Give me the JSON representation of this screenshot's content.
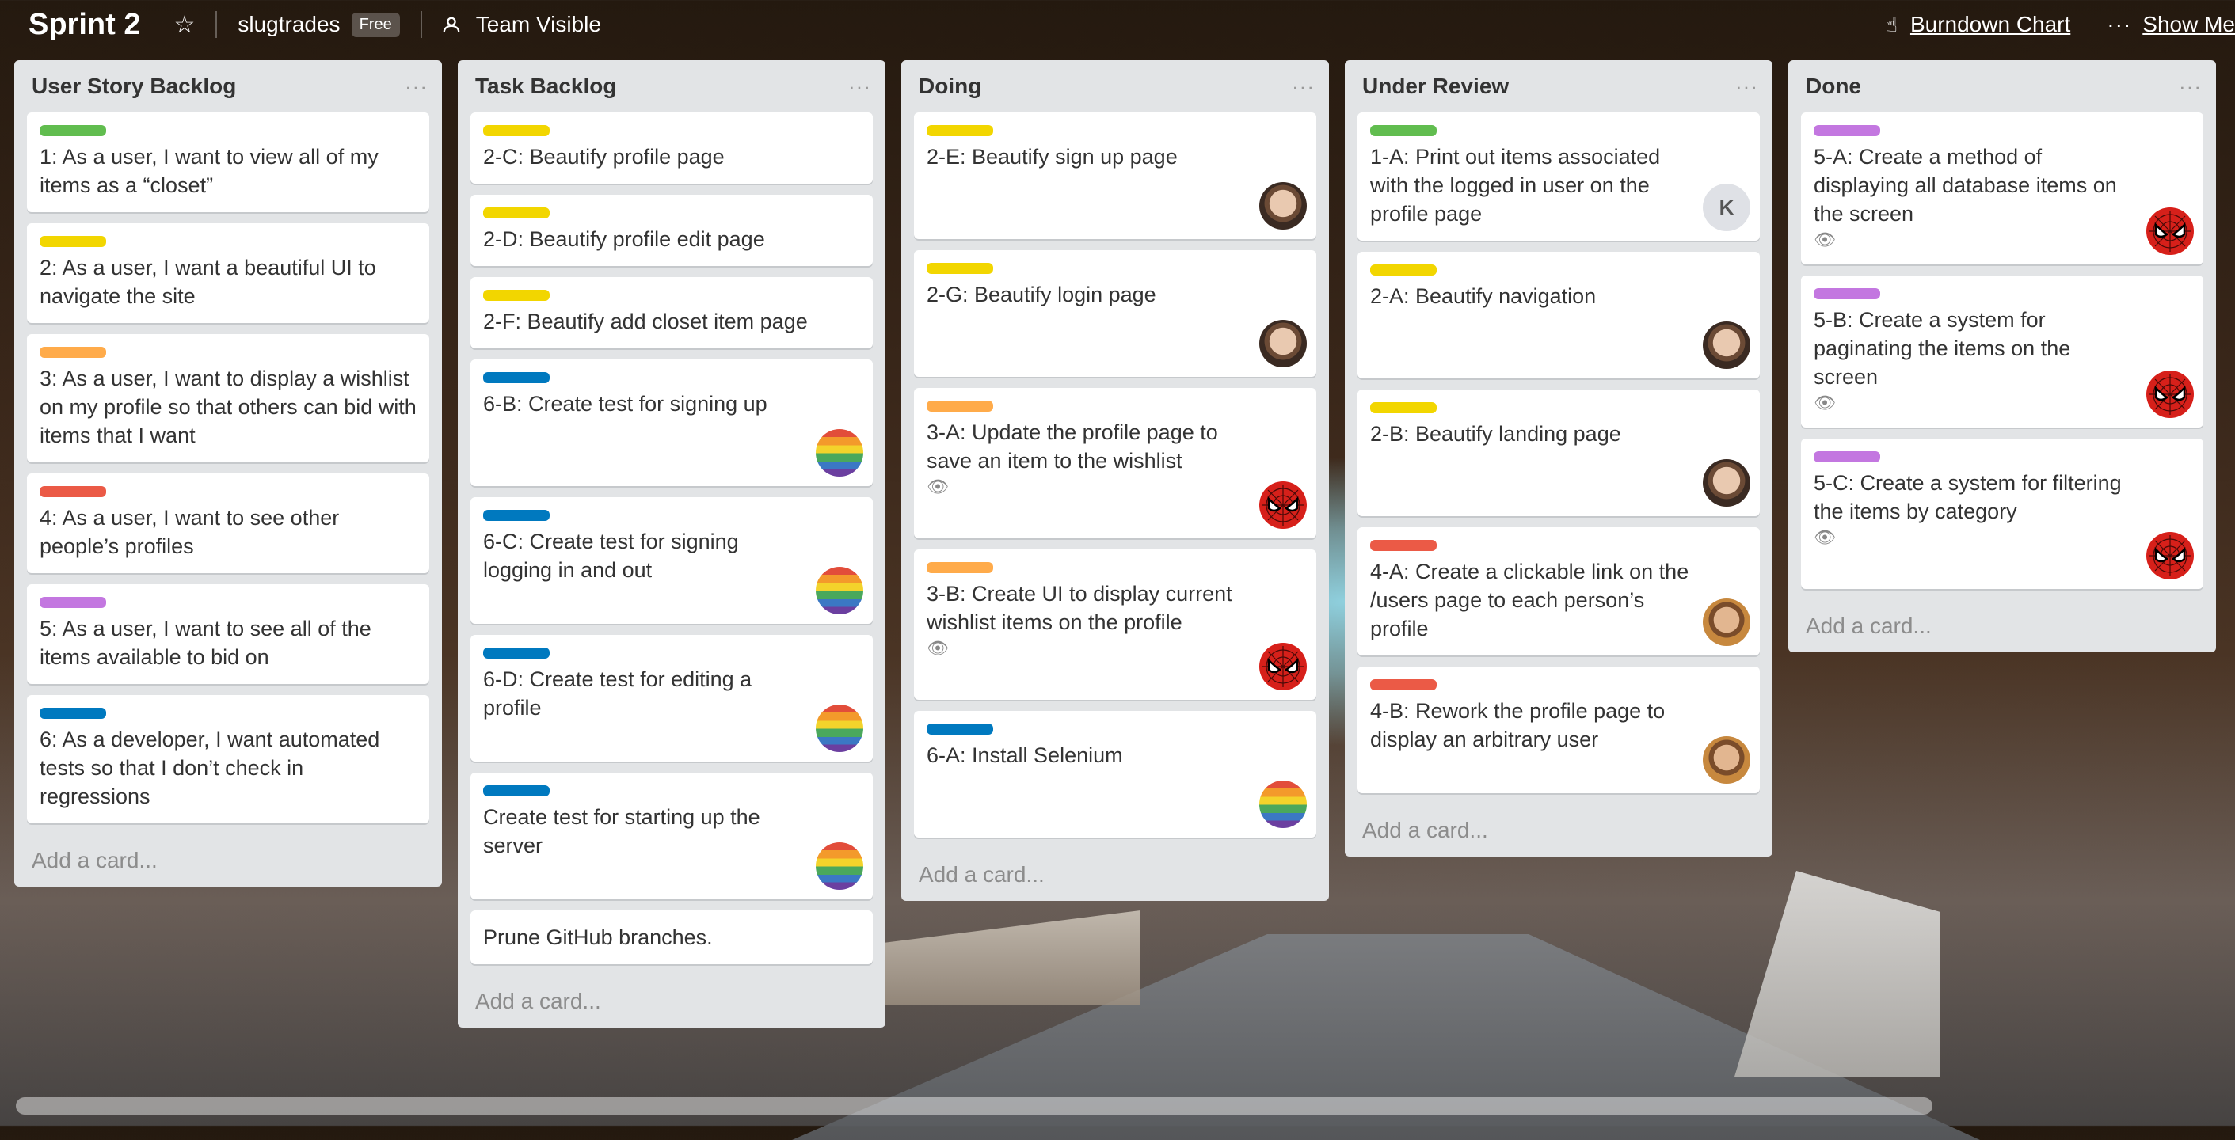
{
  "header": {
    "board_title": "Sprint 2",
    "team_name": "slugtrades",
    "plan_badge": "Free",
    "visibility": "Team Visible",
    "burndown_link": "Burndown Chart",
    "show_menu": "Show Me"
  },
  "icons": {
    "star": "star-icon",
    "person": "person-icon",
    "power_up": "hand-icon",
    "more": "ellipsis-icon",
    "watch": "eye-icon"
  },
  "colors": {
    "green": "#61bd4f",
    "yellow": "#f2d600",
    "orange": "#ffab4a",
    "red": "#eb5a46",
    "purple": "#c377e0",
    "blue": "#0079bf"
  },
  "list_menu_glyph": "···",
  "add_card_label": "Add a card...",
  "lists": [
    {
      "title": "User Story Backlog",
      "cards": [
        {
          "label": "green",
          "text": "1: As a user, I want to view all of my items as a “closet”"
        },
        {
          "label": "yellow",
          "text": "2: As a user, I want a beautiful UI to navigate the site"
        },
        {
          "label": "orange",
          "text": "3: As a user, I want to display a wishlist on my profile so that others can bid with items that I want"
        },
        {
          "label": "red",
          "text": "4: As a user, I want to see other people’s profiles"
        },
        {
          "label": "purple",
          "text": "5: As a user, I want to see all of the items available to bid on"
        },
        {
          "label": "blue",
          "text": "6: As a developer, I want automated tests so that I don’t check in regressions"
        }
      ]
    },
    {
      "title": "Task Backlog",
      "cards": [
        {
          "label": "yellow",
          "text": "2-C: Beautify profile page"
        },
        {
          "label": "yellow",
          "text": "2-D: Beautify profile edit page"
        },
        {
          "label": "yellow",
          "text": "2-F: Beautify add closet item page"
        },
        {
          "label": "blue",
          "text": "6-B: Create test for signing up",
          "avatar": "pride"
        },
        {
          "label": "blue",
          "text": "6-C: Create test for signing logging in and out",
          "avatar": "pride"
        },
        {
          "label": "blue",
          "text": "6-D: Create test for editing a profile",
          "avatar": "pride"
        },
        {
          "label": "blue",
          "text": "Create test for starting up the server",
          "avatar": "pride"
        },
        {
          "label": "",
          "text": "Prune GitHub branches."
        }
      ]
    },
    {
      "title": "Doing",
      "cards": [
        {
          "label": "yellow",
          "text": "2-E: Beautify sign up page",
          "avatar": "face"
        },
        {
          "label": "yellow",
          "text": "2-G: Beautify login page",
          "avatar": "face"
        },
        {
          "label": "orange",
          "text": "3-A: Update the profile page to save an item to the wishlist",
          "watch": true,
          "avatar": "spidey"
        },
        {
          "label": "orange",
          "text": "3-B: Create UI to display current wishlist items on the profile",
          "watch": true,
          "avatar": "spidey"
        },
        {
          "label": "blue",
          "text": "6-A: Install Selenium",
          "avatar": "pride"
        }
      ]
    },
    {
      "title": "Under Review",
      "cards": [
        {
          "label": "green",
          "text": "1-A: Print out items associated with the logged in user on the profile page",
          "avatar": "k",
          "avatar_text": "K"
        },
        {
          "label": "yellow",
          "text": "2-A: Beautify navigation",
          "avatar": "face"
        },
        {
          "label": "yellow",
          "text": "2-B: Beautify landing page",
          "avatar": "face"
        },
        {
          "label": "red",
          "text": "4-A: Create a clickable link on the /users page to each person’s profile",
          "avatar": "face2"
        },
        {
          "label": "red",
          "text": "4-B: Rework the profile page to display an arbitrary user",
          "avatar": "face2"
        }
      ]
    },
    {
      "title": "Done",
      "cards": [
        {
          "label": "purple",
          "text": "5-A: Create a method of displaying all database items on the screen",
          "watch": true,
          "avatar": "spidey"
        },
        {
          "label": "purple",
          "text": "5-B: Create a system for paginating the items on the screen",
          "watch": true,
          "avatar": "spidey"
        },
        {
          "label": "purple",
          "text": "5-C: Create a system for filtering the items by category",
          "watch": true,
          "avatar": "spidey"
        }
      ]
    }
  ]
}
